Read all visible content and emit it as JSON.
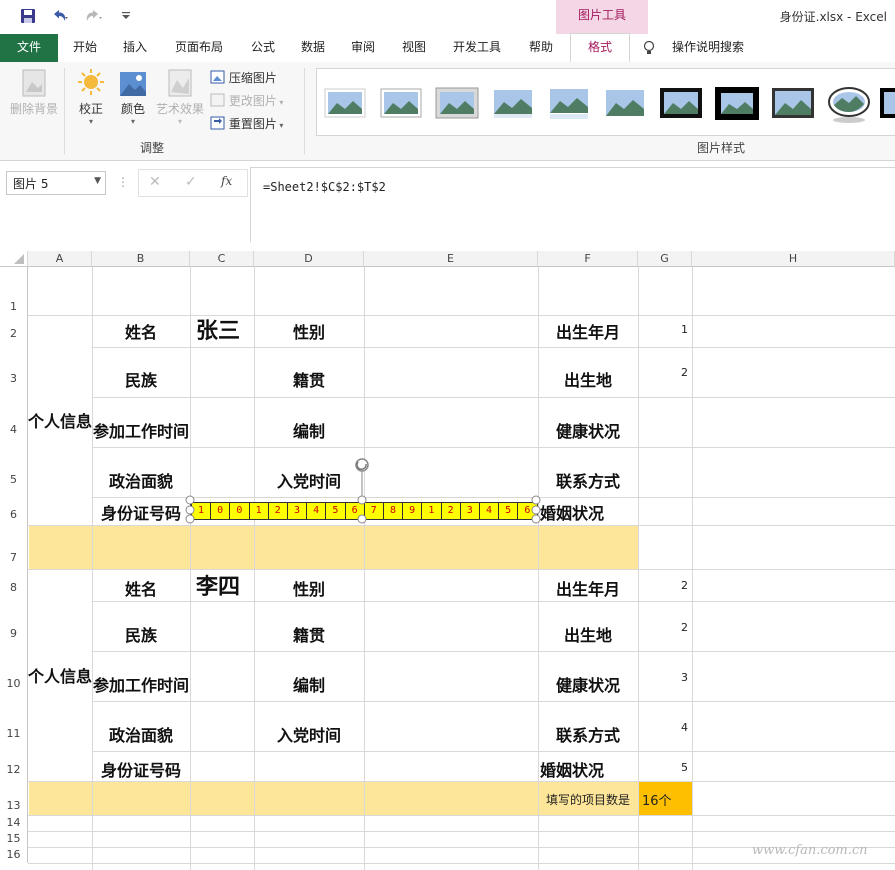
{
  "quick_access": {
    "save_icon": "save-icon",
    "undo_icon": "undo-icon",
    "redo_icon": "redo-icon",
    "customize_icon": "chevron-down-icon"
  },
  "context_tab": "图片工具",
  "document_title": "身份证.xlsx  -  Excel",
  "tabs": [
    "文件",
    "开始",
    "插入",
    "页面布局",
    "公式",
    "数据",
    "审阅",
    "视图",
    "开发工具",
    "帮助",
    "格式"
  ],
  "tell_me": "操作说明搜索",
  "ribbon": {
    "remove_bg": "删除背景",
    "corrections": "校正",
    "color": "颜色",
    "art_effects": "艺术效果",
    "compress": "压缩图片",
    "change": "更改图片",
    "reset": "重置图片",
    "group_adjust": "调整",
    "group_styles": "图片样式"
  },
  "name_box": "图片 5",
  "formula": "=Sheet2!$C$2:$T$2",
  "fx": "fx",
  "columns": [
    "A",
    "B",
    "C",
    "D",
    "E",
    "F",
    "G",
    "H"
  ],
  "rows": [
    "1",
    "2",
    "3",
    "4",
    "5",
    "6",
    "7",
    "8",
    "9",
    "10",
    "11",
    "12",
    "13",
    "14",
    "15",
    "16"
  ],
  "sheet": {
    "block1": {
      "group_label": "个人信息",
      "name_label": "姓名",
      "name_value": "张三",
      "gender": "性别",
      "birth": "出生年月",
      "birth_num": "1",
      "ethnic": "民族",
      "native": "籍贯",
      "birthplace": "出生地",
      "birthplace_num": "2",
      "work_time": "参加工作时间",
      "staffing": "编制",
      "health": "健康状况",
      "politics": "政治面貌",
      "party_time": "入党时间",
      "contact": "联系方式",
      "id_label": "身份证号码",
      "marital": "婚姻状况"
    },
    "barcode_digits": [
      "1",
      "0",
      "0",
      "1",
      "2",
      "3",
      "4",
      "5",
      "6",
      "7",
      "8",
      "9",
      "1",
      "2",
      "3",
      "4",
      "5",
      "6"
    ],
    "block2": {
      "group_label": "个人信息",
      "name_label": "姓名",
      "name_value": "李四",
      "gender": "性别",
      "birth": "出生年月",
      "birth_num": "2",
      "ethnic": "民族",
      "native": "籍贯",
      "birthplace": "出生地",
      "birthplace_num": "2",
      "work_time": "参加工作时间",
      "staffing": "编制",
      "health": "健康状况",
      "health_num": "3",
      "politics": "政治面貌",
      "party_time": "入党时间",
      "contact": "联系方式",
      "contact_num": "4",
      "id_label": "身份证号码",
      "marital": "婚姻状况",
      "marital_num": "5"
    },
    "count_label": "填写的项目数是",
    "count_value": "16个"
  },
  "watermark": "www.cfan.com.cn",
  "colors": {
    "excel_green": "#217346",
    "context_pink": "#a4195c",
    "band": "#fde699",
    "count_fill": "#fdbf00",
    "barcode": "#ffff00"
  }
}
